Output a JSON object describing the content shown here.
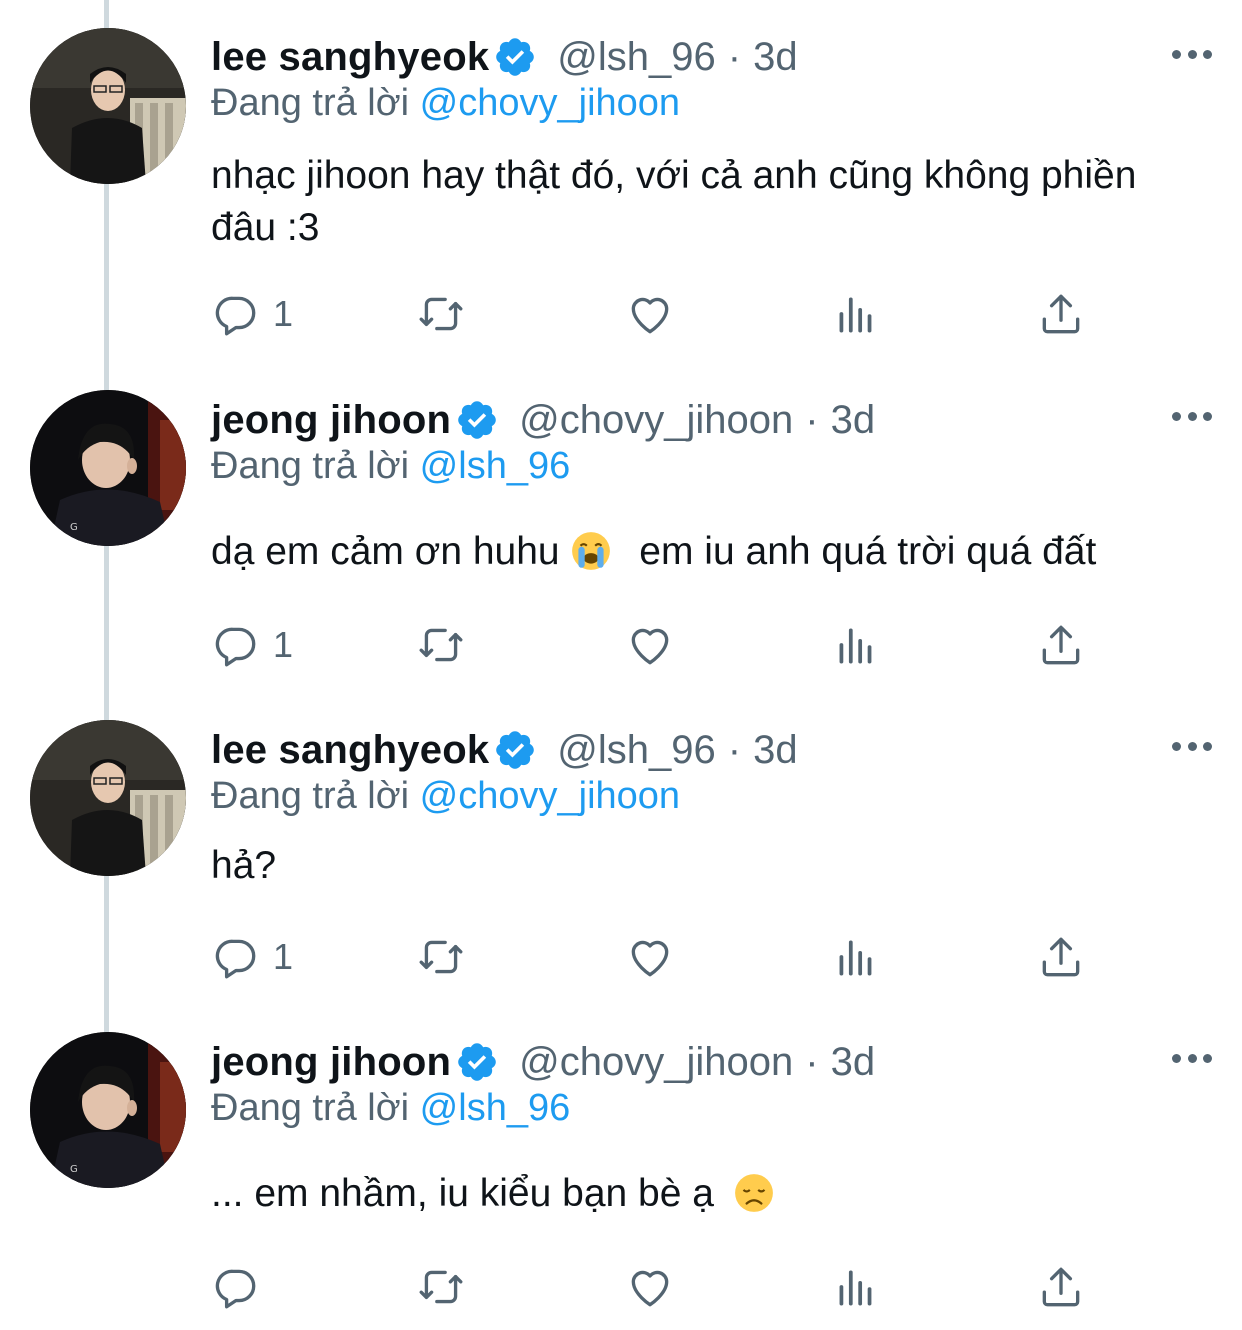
{
  "tweets": [
    {
      "name": "lee sanghyeok",
      "handle": "@lsh_96",
      "separator": "·",
      "time": "3d",
      "reply_prefix": "Đang trả lời",
      "reply_to": "@chovy_jihoon",
      "text": "nhạc jihoon hay thật đó, với cả anh cũng không phiền đâu :3",
      "reply_count": "1"
    },
    {
      "name": "jeong jihoon",
      "handle": "@chovy_jihoon",
      "separator": "·",
      "time": "3d",
      "reply_prefix": "Đang trả lời",
      "reply_to": "@lsh_96",
      "text_before_emoji": "dạ em cảm ơn huhu",
      "emoji": "loudly-crying-face-emoji",
      "text_after_emoji": "em iu anh quá trời quá đất",
      "reply_count": "1"
    },
    {
      "name": "lee sanghyeok",
      "handle": "@lsh_96",
      "separator": "·",
      "time": "3d",
      "reply_prefix": "Đang trả lời",
      "reply_to": "@chovy_jihoon",
      "text": "hả?",
      "reply_count": "1"
    },
    {
      "name": "jeong jihoon",
      "handle": "@chovy_jihoon",
      "separator": "·",
      "time": "3d",
      "reply_prefix": "Đang trả lời",
      "reply_to": "@lsh_96",
      "text_before_emoji": "... em nhầm, iu kiểu bạn bè ạ",
      "emoji": "disappointed-face-emoji",
      "reply_count": ""
    }
  ],
  "icons": {
    "reply": "reply-icon",
    "retweet": "retweet-icon",
    "like": "heart-icon",
    "views": "analytics-icon",
    "share": "share-icon",
    "verified": "verified-badge-icon",
    "more": "more-options-icon"
  },
  "colors": {
    "accent": "#1d9bf0",
    "secondary_text": "#536471",
    "thread_line": "#cfd9de"
  }
}
